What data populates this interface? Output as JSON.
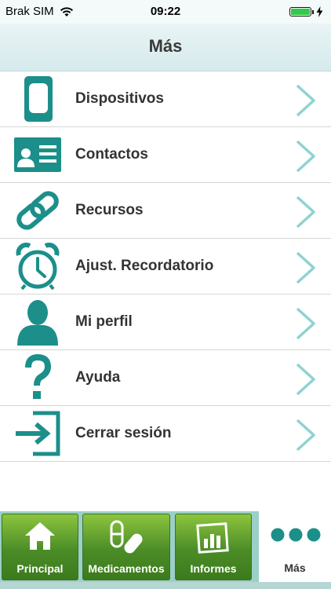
{
  "status_bar": {
    "carrier": "Brak SIM",
    "time": "09:22"
  },
  "nav": {
    "title": "Más"
  },
  "menu": {
    "items": [
      {
        "label": "Dispositivos",
        "icon": "device-icon"
      },
      {
        "label": "Contactos",
        "icon": "contact-card-icon"
      },
      {
        "label": "Recursos",
        "icon": "link-icon"
      },
      {
        "label": "Ajust. Recordatorio",
        "icon": "alarm-clock-icon"
      },
      {
        "label": "Mi perfil",
        "icon": "person-icon"
      },
      {
        "label": "Ayuda",
        "icon": "question-mark-icon"
      },
      {
        "label": "Cerrar sesión",
        "icon": "logout-icon"
      }
    ]
  },
  "tabs": [
    {
      "label": "Principal",
      "icon": "home-icon"
    },
    {
      "label": "Medicamentos",
      "icon": "pills-icon"
    },
    {
      "label": "Informes",
      "icon": "chart-icon"
    },
    {
      "label": "Más",
      "icon": "more-dots-icon",
      "active": true
    }
  ],
  "colors": {
    "accent": "#1c8f8a",
    "chevron": "#8fd3d0",
    "tab_green": "#4b8c27",
    "active_underline": "#26a3a3",
    "battery": "#36c84a"
  },
  "battery_level": 1.0
}
